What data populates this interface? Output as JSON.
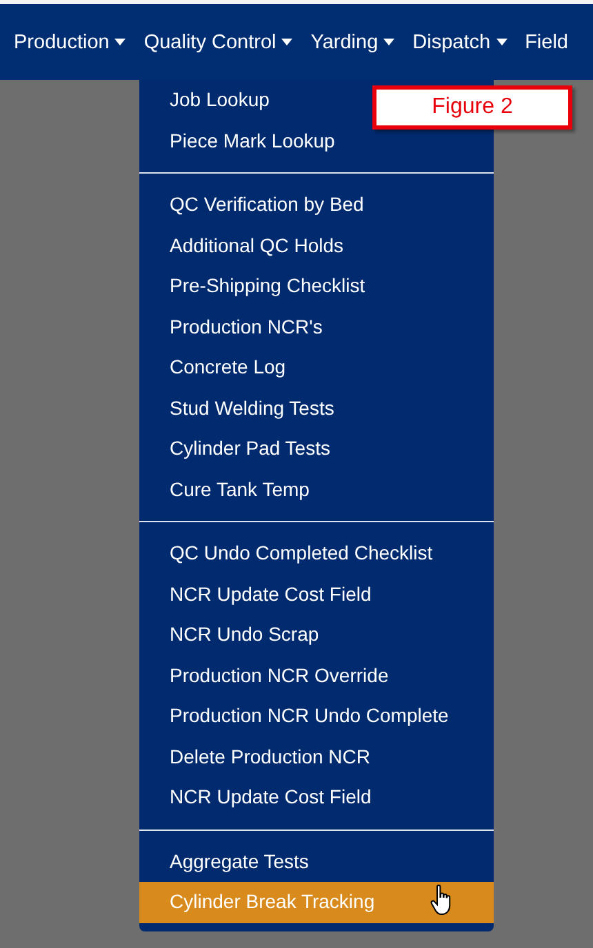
{
  "nav": [
    {
      "label": "Production",
      "caret": true
    },
    {
      "label": "Quality Control",
      "caret": true
    },
    {
      "label": "Yarding",
      "caret": true
    },
    {
      "label": "Dispatch",
      "caret": true
    },
    {
      "label": "Field",
      "caret": false
    }
  ],
  "menu": {
    "groups": [
      [
        {
          "label": "Job Lookup",
          "selected": false
        },
        {
          "label": "Piece Mark Lookup",
          "selected": false
        }
      ],
      [
        {
          "label": "QC Verification by Bed",
          "selected": false
        },
        {
          "label": "Additional QC Holds",
          "selected": false
        },
        {
          "label": "Pre-Shipping Checklist",
          "selected": false
        },
        {
          "label": "Production NCR's",
          "selected": false
        },
        {
          "label": "Concrete Log",
          "selected": false
        },
        {
          "label": "Stud Welding Tests",
          "selected": false
        },
        {
          "label": "Cylinder Pad Tests",
          "selected": false
        },
        {
          "label": "Cure Tank Temp",
          "selected": false
        }
      ],
      [
        {
          "label": "QC Undo Completed Checklist",
          "selected": false
        },
        {
          "label": "NCR Update Cost Field",
          "selected": false
        },
        {
          "label": "NCR Undo Scrap",
          "selected": false
        },
        {
          "label": "Production NCR Override",
          "selected": false
        },
        {
          "label": "Production NCR Undo Complete",
          "selected": false
        },
        {
          "label": "Delete Production NCR",
          "selected": false
        },
        {
          "label": "NCR Update Cost Field",
          "selected": false
        }
      ],
      [
        {
          "label": "Aggregate Tests",
          "selected": false
        },
        {
          "label": "Cylinder Break Tracking",
          "selected": true
        }
      ]
    ]
  },
  "callout": {
    "text": "Figure 2"
  }
}
